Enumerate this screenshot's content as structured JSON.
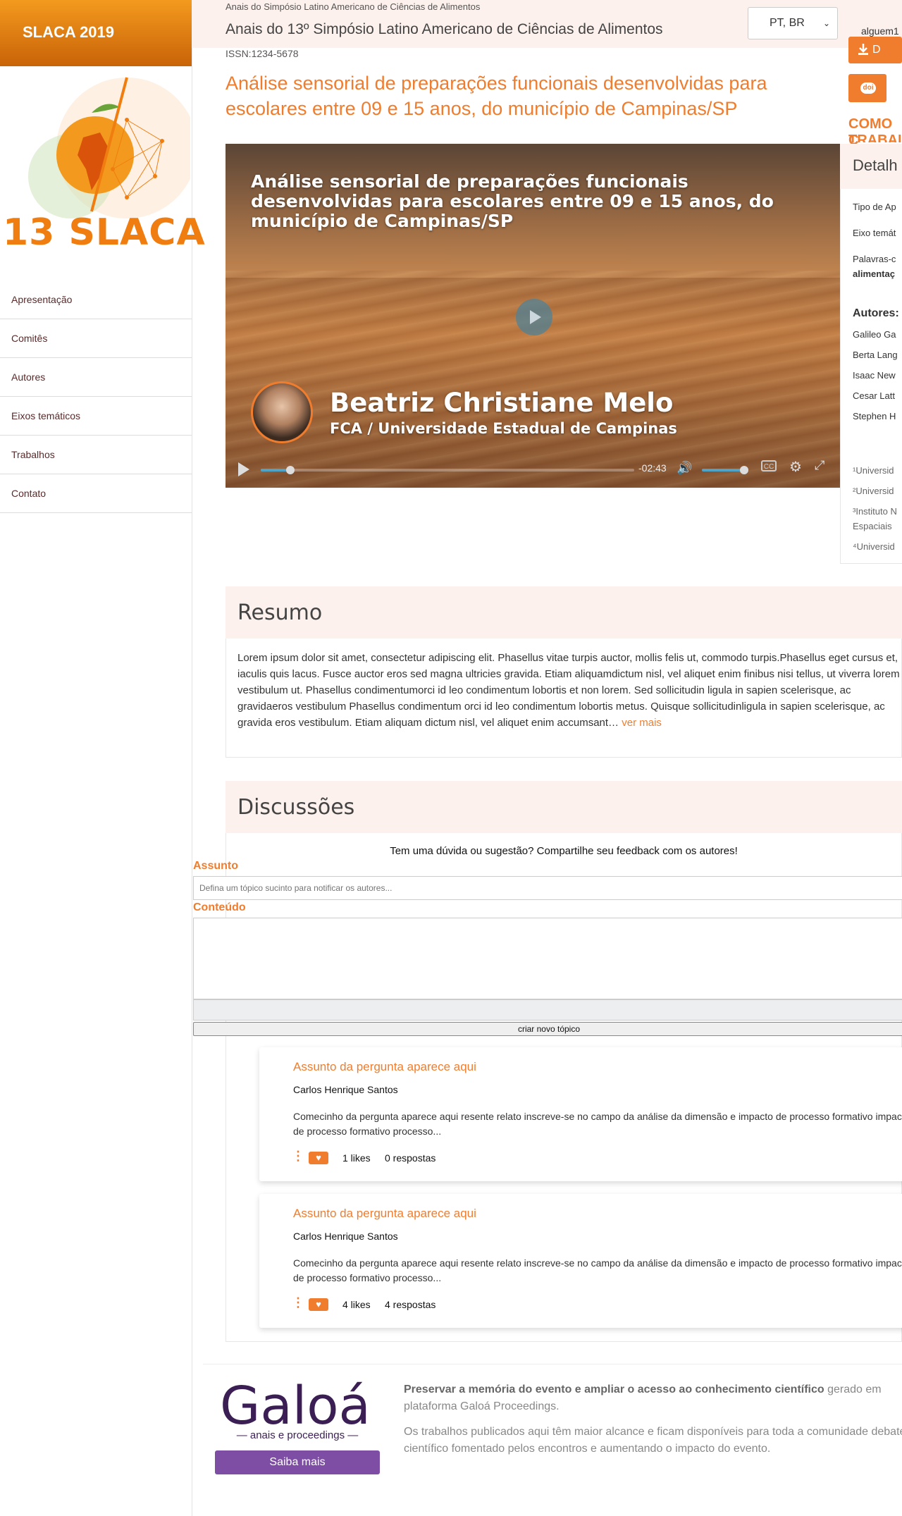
{
  "sidebar": {
    "brand": "SLACA 2019",
    "logo_text": "13 SLACA",
    "items": [
      {
        "label": "Apresentação"
      },
      {
        "label": "Comitês"
      },
      {
        "label": "Autores"
      },
      {
        "label": "Eixos temáticos"
      },
      {
        "label": "Trabalhos"
      },
      {
        "label": "Contato"
      }
    ]
  },
  "header": {
    "breadcrumb": "Anais do Simpósio Latino Americano de Ciências de Alimentos",
    "proceedings_title": "Anais do 13º Simpósio Latino Americano de Ciências de Alimentos",
    "issn": "ISSN:1234-5678",
    "language": "PT, BR",
    "user": "alguem1",
    "download_label": "D",
    "doi_label": "doi",
    "como_citar": "COMO C",
    "como_citar_2": "TRABAL"
  },
  "paper": {
    "title": "Análise sensorial de preparações funcionais desenvolvidas para escolares entre 09 e 15 anos, do município de Campinas/SP"
  },
  "video": {
    "title": "Análise sensorial de preparações funcionais desenvolvidas para escolares entre 09 e 15 anos, do município de Campinas/SP",
    "speaker": "Beatriz Christiane Melo",
    "affiliation": "FCA / Universidade Estadual de Campinas",
    "time_remaining": "-02:43",
    "progress": 0.08,
    "volume": 0.85
  },
  "details": {
    "title": "Detalh",
    "tipo": "Tipo de Ap",
    "eixo": "Eixo temát",
    "palavras": "Palavras-c",
    "palavras_value": "alimentaç",
    "autores_label": "Autores:",
    "autores": [
      "Galileo Ga",
      "Berta Lang",
      "Isaac New",
      "Cesar Latt",
      "Stephen H"
    ],
    "affiliations": [
      "¹Universid",
      "²Universid",
      "³Instituto N",
      "Espaciais",
      "⁴Universid"
    ]
  },
  "resumo": {
    "title": "Resumo",
    "text": "Lorem ipsum dolor sit amet, consectetur adipiscing elit. Phasellus vitae turpis auctor, mollis felis ut, commodo turpis.Phasellus eget cursus et, iaculis quis lacus. Fusce auctor eros sed magna ultricies gravida. Etiam aliquamdictum nisl, vel aliquet enim finibus nisi tellus, ut viverra lorem vestibulum ut. Phasellus condimentumorci id leo condimentum lobortis et non lorem. Sed sollicitudin ligula in sapien scelerisque, ac gravidaeros vestibulum Phasellus condimentum orci id leo condimentum lobortis metus. Quisque sollicitudinligula in sapien scelerisque, ac gravida eros vestibulum. Etiam aliquam dictum nisl, vel aliquet enim accumsant…",
    "ver_mais": "ver mais"
  },
  "discussions": {
    "title": "Discussões",
    "prompt": "Tem uma dúvida ou sugestão? Compartilhe seu feedback com os autores!",
    "assunto_label": "Assunto",
    "assunto_placeholder": "Defina um tópico sucinto para notificar os autores...",
    "conteudo_label": "Conteúdo",
    "submit_label": "criar novo tópico",
    "questions": [
      {
        "title": "Assunto da pergunta aparece aqui",
        "author": "Carlos Henrique Santos",
        "text": "Comecinho da pergunta aparece aqui resente relato inscreve-se no campo da análise da dimensão e impacto de processo formativo impacto de processo formativo processo...",
        "likes": "1 likes",
        "replies": "0 respostas"
      },
      {
        "title": "Assunto da pergunta aparece aqui",
        "author": "Carlos Henrique Santos",
        "text": "Comecinho da pergunta aparece aqui resente relato inscreve-se no campo da análise da dimensão e impacto de processo formativo impacto de processo formativo processo...",
        "likes": "4 likes",
        "replies": "4 respostas"
      }
    ]
  },
  "footer": {
    "brand": "Galoá",
    "subtitle": "anais e proceedings",
    "button": "Saiba mais",
    "p1_bold": "Preservar a memória do evento e ampliar o acesso ao conhecimento científico",
    "p1_rest": " gerado em plataforma Galoá Proceedings.",
    "p2": "Os trabalhos publicados aqui têm maior alcance e ficam disponíveis para toda a comunidade debate científico fomentado pelos encontros e aumentando o impacto do evento."
  },
  "colors": {
    "accent": "#f07d2e",
    "header_bg": "#fcf1ec",
    "galoa_purple": "#3b1f54"
  }
}
